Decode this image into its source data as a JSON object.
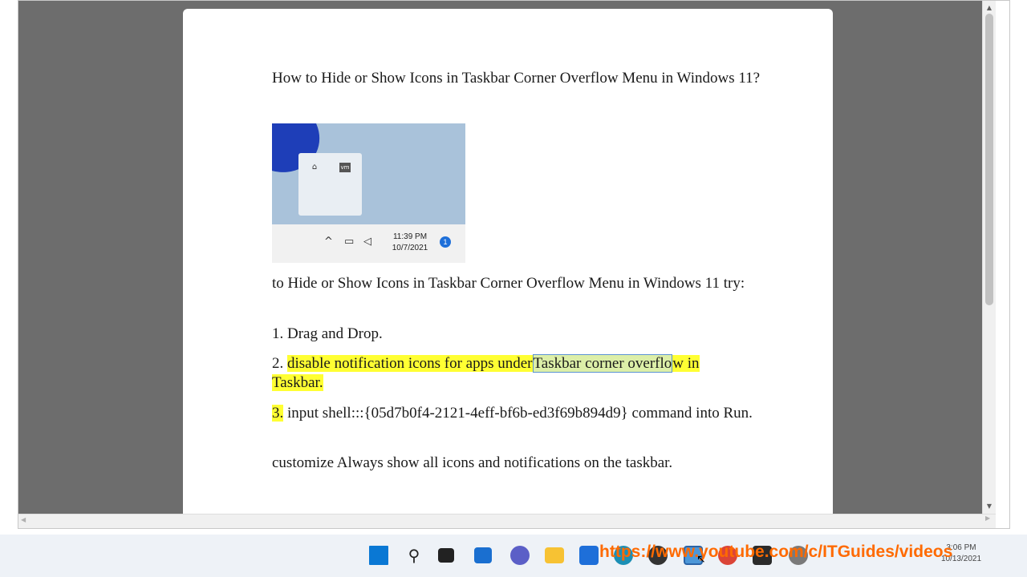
{
  "document": {
    "title": "How to Hide or Show Icons in Taskbar Corner Overflow Menu in Windows 11?",
    "intro": "to Hide or Show Icons in Taskbar Corner Overflow Menu in Windows 11 try:",
    "step1": "1. Drag and Drop.",
    "step2_num": "2.",
    "step2_a": "disable notification icons for apps under",
    "step2_b": "Taskbar corner overflo",
    "step2_c": "w in",
    "step2_d": "Taskbar.",
    "step3_num": "3.",
    "step3_text": "input shell:::{05d7b0f4-2121-4eff-bf6b-ed3f69b894d9} command into Run.",
    "step4": "customize Always show all icons and notifications on the taskbar.",
    "image": {
      "time": "11:39 PM",
      "date": "10/7/2021",
      "badge": "1",
      "flyout_icon_2": "vm"
    }
  },
  "taskbar": {
    "time": "3:06 PM",
    "date": "10/13/2021",
    "icons": [
      "windows-start-icon",
      "search-icon",
      "task-view-icon",
      "widgets-icon",
      "chat-icon",
      "file-explorer-icon",
      "microsoft-store-icon",
      "edge-icon",
      "obs-icon",
      "app-icon",
      "chrome-icon",
      "terminal-icon",
      "settings-icon"
    ]
  },
  "watermark": "https://www.youtube.com/c/ITGuides/videos",
  "colors": {
    "highlight": "#ffff33",
    "viewport_bg": "#6d6d6d",
    "watermark": "#ff6a00",
    "start_blue": "#0a78d4"
  }
}
